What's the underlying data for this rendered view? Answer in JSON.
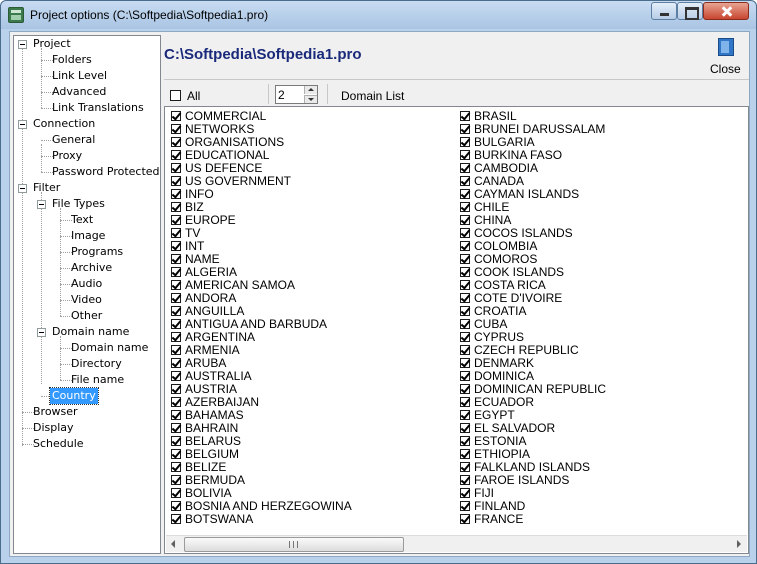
{
  "window": {
    "title": "Project options (C:\\Softpedia\\Softpedia1.pro)"
  },
  "tree": {
    "project": "Project",
    "folders": "Folders",
    "link_level": "Link Level",
    "advanced": "Advanced",
    "link_translations": "Link Translations",
    "connection": "Connection",
    "general": "General",
    "proxy": "Proxy",
    "password_protected": "Password Protected",
    "filter": "Filter",
    "file_types": "File Types",
    "text": "Text",
    "image": "Image",
    "programs": "Programs",
    "archive": "Archive",
    "audio": "Audio",
    "video": "Video",
    "other": "Other",
    "domain_name_group": "Domain name",
    "domain_name": "Domain name",
    "directory": "Directory",
    "file_name": "File name",
    "country": "Country",
    "browser": "Browser",
    "display": "Display",
    "schedule": "Schedule"
  },
  "header": {
    "path": "C:\\Softpedia\\Softpedia1.pro",
    "close_label": "Close",
    "close_icon": "exit-door-icon"
  },
  "toolbar": {
    "all_label": "All",
    "all_checked": false,
    "spinner_value": "2",
    "domain_list_label": "Domain List"
  },
  "domains": {
    "left": [
      "COMMERCIAL",
      "NETWORKS",
      "ORGANISATIONS",
      "EDUCATIONAL",
      "US DEFENCE",
      "US GOVERNMENT",
      "INFO",
      "BIZ",
      "EUROPE",
      "TV",
      "INT",
      "NAME",
      "ALGERIA",
      "AMERICAN SAMOA",
      "ANDORA",
      "ANGUILLA",
      "ANTIGUA AND BARBUDA",
      "ARGENTINA",
      "ARMENIA",
      "ARUBA",
      "AUSTRALIA",
      "AUSTRIA",
      "AZERBAIJAN",
      "BAHAMAS",
      "BAHRAIN",
      "BELARUS",
      "BELGIUM",
      "BELIZE",
      "BERMUDA",
      "BOLIVIA",
      "BOSNIA AND HERZEGOWINA",
      "BOTSWANA"
    ],
    "right": [
      "BRASIL",
      "BRUNEI DARUSSALAM",
      "BULGARIA",
      "BURKINA FASO",
      "CAMBODIA",
      "CANADA",
      "CAYMAN ISLANDS",
      "CHILE",
      "CHINA",
      "COCOS ISLANDS",
      "COLOMBIA",
      "COMOROS",
      "COOK ISLANDS",
      "COSTA RICA",
      "COTE D'IVOIRE",
      "CROATIA",
      "CUBA",
      "CYPRUS",
      "CZECH REPUBLIC",
      "DENMARK",
      "DOMINICA",
      "DOMINICAN REPUBLIC",
      "ECUADOR",
      "EGYPT",
      "EL SALVADOR",
      "ESTONIA",
      "ETHIOPIA",
      "FALKLAND ISLANDS",
      "FAROE ISLANDS",
      "FIJI",
      "FINLAND",
      "FRANCE"
    ],
    "all_checked": true
  }
}
